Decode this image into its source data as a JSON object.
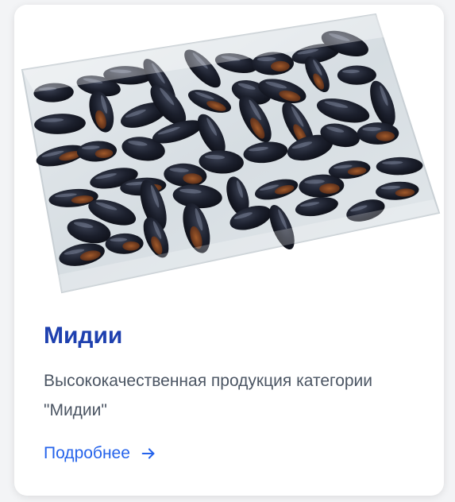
{
  "product": {
    "title": "Мидии",
    "description": "Высококачественная продукция категории \"Мидии\"",
    "link_label": "Подробнее",
    "image": "frozen-mussels-vacuum-pack",
    "icons": {
      "link": "arrow-right-icon"
    }
  },
  "colors": {
    "title": "#1e40af",
    "description": "#4b5563",
    "link": "#2563eb",
    "card_background": "#ffffff",
    "page_background": "#f3f4f6"
  }
}
